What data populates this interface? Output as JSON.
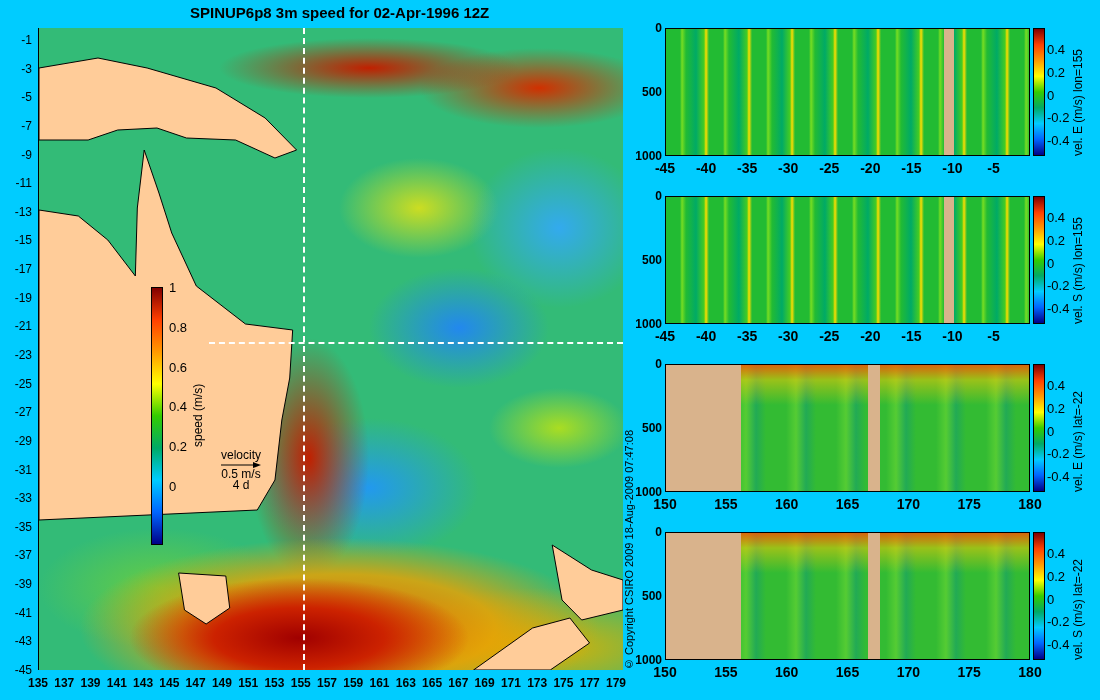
{
  "title": "SPINUP6p8 3m speed for 02-Apr-1996 12Z",
  "map": {
    "y_ticks": [
      "-1",
      "-3",
      "-5",
      "-7",
      "-9",
      "-11",
      "-13",
      "-15",
      "-17",
      "-19",
      "-21",
      "-23",
      "-25",
      "-27",
      "-29",
      "-31",
      "-33",
      "-35",
      "-37",
      "-39",
      "-41",
      "-43",
      "-45"
    ],
    "x_ticks": [
      "135",
      "137",
      "139",
      "141",
      "143",
      "145",
      "147",
      "149",
      "151",
      "153",
      "155",
      "157",
      "159",
      "161",
      "163",
      "165",
      "167",
      "169",
      "171",
      "173",
      "175",
      "177",
      "179"
    ],
    "colorbar": {
      "label": "speed (m/s)",
      "ticks": [
        "1",
        "0.8",
        "0.6",
        "0.4",
        "0.2",
        "0"
      ]
    },
    "legend": {
      "title": "velocity",
      "scale": "0.5 m/s",
      "duration": "4 d"
    }
  },
  "copyright": "© Copyright CSIRO 2009  18-Aug-2009 07:47:08",
  "sections": [
    {
      "kind": "lon",
      "label": "vel. E (m/s) lon=155",
      "y_ticks": [
        "0",
        "500",
        "1000"
      ],
      "x_ticks": [
        "-45",
        "-40",
        "-35",
        "-30",
        "-25",
        "-20",
        "-15",
        "-10",
        "-5"
      ],
      "colorbar_ticks": [
        "0.4",
        "0.2",
        "0",
        "-0.2",
        "-0.4"
      ]
    },
    {
      "kind": "lon",
      "label": "vel. S (m/s) lon=155",
      "y_ticks": [
        "0",
        "500",
        "1000"
      ],
      "x_ticks": [
        "-45",
        "-40",
        "-35",
        "-30",
        "-25",
        "-20",
        "-15",
        "-10",
        "-5"
      ],
      "colorbar_ticks": [
        "0.4",
        "0.2",
        "0",
        "-0.2",
        "-0.4"
      ]
    },
    {
      "kind": "lat",
      "label": "vel. E (m/s) lat=-22",
      "y_ticks": [
        "0",
        "500",
        "1000"
      ],
      "x_ticks": [
        "150",
        "155",
        "160",
        "165",
        "170",
        "175",
        "180"
      ],
      "colorbar_ticks": [
        "0.4",
        "0.2",
        "0",
        "-0.2",
        "-0.4"
      ]
    },
    {
      "kind": "lat",
      "label": "vel. S (m/s) lat=-22",
      "y_ticks": [
        "0",
        "500",
        "1000"
      ],
      "x_ticks": [
        "150",
        "155",
        "160",
        "165",
        "170",
        "175",
        "180"
      ],
      "colorbar_ticks": [
        "0.4",
        "0.2",
        "0",
        "-0.2",
        "-0.4"
      ]
    }
  ]
}
